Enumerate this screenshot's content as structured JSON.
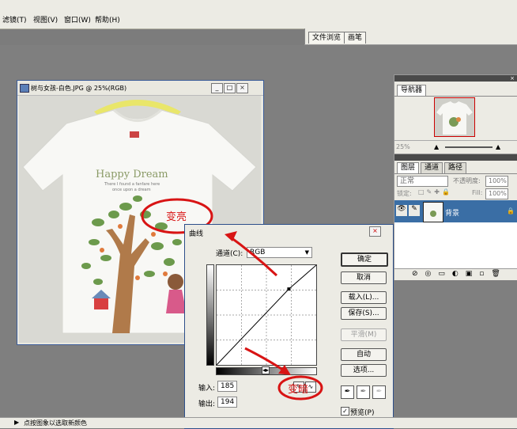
{
  "menu": {
    "items": [
      "滤镜(T)",
      "视图(V)",
      "窗口(W)",
      "帮助(H)"
    ]
  },
  "palette_well": {
    "tabs": [
      "文件浏览",
      "画笔"
    ]
  },
  "document": {
    "title": "树与女孩-白色.JPG @ 25%(RGB)",
    "shirt_text_1": "Happy Dream",
    "shirt_text_2": "There I found a fanfare here",
    "shirt_text_3": "once upon a dream",
    "annotation": "变亮"
  },
  "navigator": {
    "tab": "导航器",
    "zoom": "25%"
  },
  "layers": {
    "tabs": [
      "图层",
      "通道",
      "路径"
    ],
    "blend_mode": "正常",
    "opacity_label": "不透明度:",
    "opacity_value": "100%",
    "lock_label": "锁定:",
    "fill_label": "Fill:",
    "fill_value": "100%",
    "layer_name": "背景"
  },
  "curves": {
    "title": "曲线",
    "channel_label": "通道(C):",
    "channel_value": "RGB",
    "buttons": {
      "ok": "确定",
      "cancel": "取消",
      "load": "载入(L)...",
      "save": "保存(S)...",
      "smooth": "平滑(M)",
      "auto": "自动",
      "options": "选项..."
    },
    "input_label": "输入:",
    "input_value": "185",
    "output_label": "输出:",
    "output_value": "194",
    "preview_label": "预览(P)",
    "annotation": "变暗"
  },
  "status": {
    "text": "点按图象以选取新颜色"
  },
  "colors": {
    "menubar": "#ecebe4",
    "workspace": "#7f7f7f",
    "selection": "#3a6ea5",
    "annotation_red": "#d81414"
  }
}
